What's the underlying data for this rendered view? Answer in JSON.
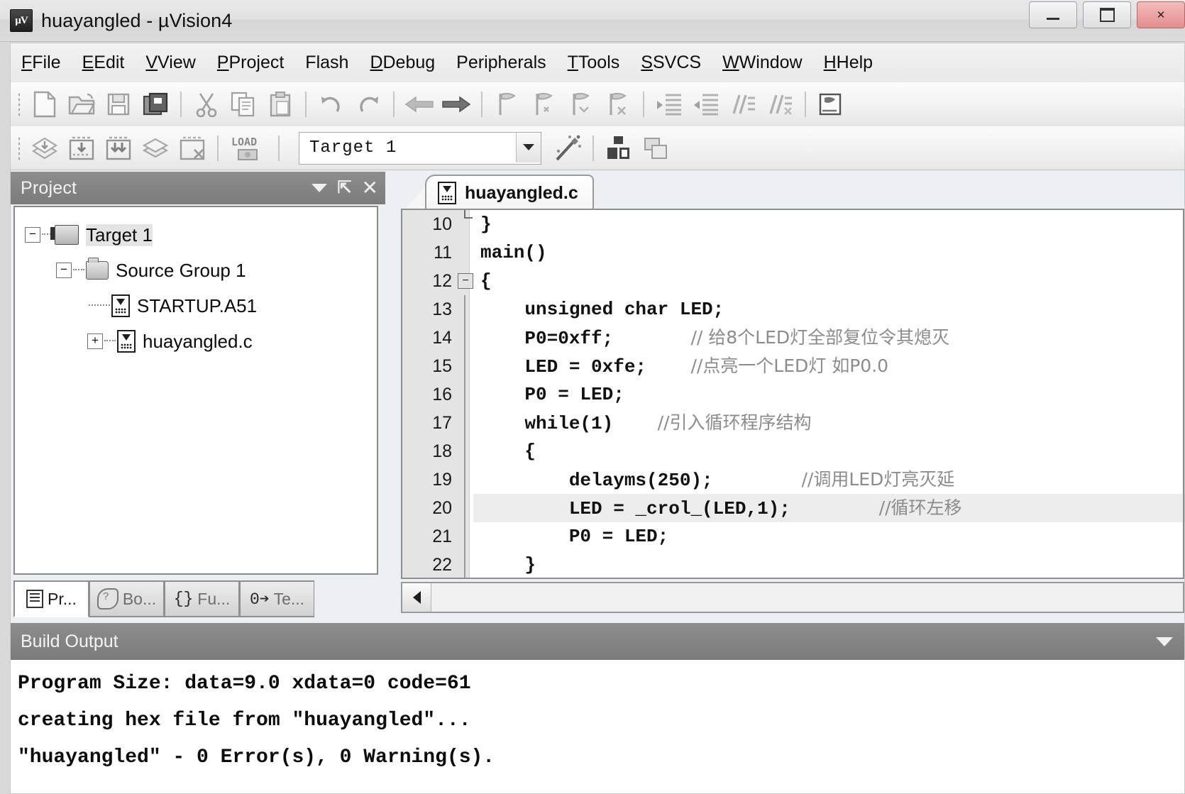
{
  "window": {
    "title": "huayangled  - µVision4",
    "app_icon": "uvision-icon",
    "buttons": {
      "minimize": "minimize-button",
      "maximize": "maximize-button",
      "close": "close-button"
    }
  },
  "menubar": {
    "items": [
      {
        "label": "File",
        "mnemonic": "F"
      },
      {
        "label": "Edit",
        "mnemonic": "E"
      },
      {
        "label": "View",
        "mnemonic": "V"
      },
      {
        "label": "Project",
        "mnemonic": "P"
      },
      {
        "label": "Flash",
        "mnemonic": "a"
      },
      {
        "label": "Debug",
        "mnemonic": "D"
      },
      {
        "label": "Peripherals",
        "mnemonic": "r"
      },
      {
        "label": "Tools",
        "mnemonic": "T"
      },
      {
        "label": "SVCS",
        "mnemonic": "S"
      },
      {
        "label": "Window",
        "mnemonic": "W"
      },
      {
        "label": "Help",
        "mnemonic": "H"
      }
    ]
  },
  "toolbar_file": {
    "buttons": [
      {
        "name": "new-file-icon",
        "glyph": "⬜"
      },
      {
        "name": "open-file-icon",
        "glyph": "📂"
      },
      {
        "name": "save-icon",
        "glyph": "💾"
      },
      {
        "name": "save-all-icon",
        "glyph": "📚"
      },
      {
        "name": "cut-icon",
        "glyph": "✂"
      },
      {
        "name": "copy-icon",
        "glyph": "⧉"
      },
      {
        "name": "paste-icon",
        "glyph": "📋"
      },
      {
        "name": "undo-icon",
        "glyph": "↶"
      },
      {
        "name": "redo-icon",
        "glyph": "↷"
      },
      {
        "name": "navigate-back-icon",
        "glyph": "⇐"
      },
      {
        "name": "navigate-forward-icon",
        "glyph": "⇒"
      },
      {
        "name": "bookmark-toggle-icon",
        "glyph": "⚑"
      },
      {
        "name": "bookmark-prev-icon",
        "glyph": "⚑"
      },
      {
        "name": "bookmark-next-icon",
        "glyph": "⚑"
      },
      {
        "name": "bookmark-clear-icon",
        "glyph": "⚑"
      },
      {
        "name": "indent-icon",
        "glyph": "≡"
      },
      {
        "name": "outdent-icon",
        "glyph": "≡"
      },
      {
        "name": "comment-icon",
        "glyph": "//"
      },
      {
        "name": "uncomment-icon",
        "glyph": "//"
      },
      {
        "name": "bookmark-window-icon",
        "glyph": "⎙"
      }
    ]
  },
  "toolbar_build": {
    "buttons": [
      {
        "name": "translate-icon",
        "glyph": "◧"
      },
      {
        "name": "build-target-icon",
        "glyph": "⬇"
      },
      {
        "name": "rebuild-all-icon",
        "glyph": "⬇"
      },
      {
        "name": "batch-build-icon",
        "glyph": "◩"
      },
      {
        "name": "stop-build-icon",
        "glyph": "✗"
      },
      {
        "name": "download-icon",
        "glyph": "LOAD"
      },
      {
        "name": "options-for-target-icon",
        "glyph": "✨"
      },
      {
        "name": "manage-components-icon",
        "glyph": "▣"
      },
      {
        "name": "multi-project-icon",
        "glyph": "❐"
      }
    ],
    "load_label": "LOAD",
    "target_select": {
      "value": "Target 1",
      "name": "target-select"
    }
  },
  "project_panel": {
    "title": "Project",
    "tree": [
      {
        "label": "Target 1",
        "level": 0,
        "icon": "target-icon",
        "expander": "−",
        "selected": true
      },
      {
        "label": "Source Group 1",
        "level": 1,
        "icon": "folder-icon",
        "expander": "−",
        "selected": false
      },
      {
        "label": "STARTUP.A51",
        "level": 2,
        "icon": "file-icon",
        "expander": "",
        "selected": false
      },
      {
        "label": "huayangled.c",
        "level": 2,
        "icon": "file-icon",
        "expander": "+",
        "selected": false
      }
    ],
    "tabs": [
      {
        "label": "Pr...",
        "icon": "project-icon",
        "active": true
      },
      {
        "label": "Bo...",
        "icon": "books-icon",
        "active": false
      },
      {
        "label": "Fu...",
        "icon": "functions-icon",
        "prefix": "{}",
        "active": false
      },
      {
        "label": "Te...",
        "icon": "templates-icon",
        "prefix": "0➔",
        "active": false
      }
    ]
  },
  "editor": {
    "tab": {
      "label": "huayangled.c",
      "icon": "c-file-icon"
    },
    "lines": [
      {
        "num": "10",
        "fold": "end",
        "text": "}",
        "comment": "",
        "highlight": false
      },
      {
        "num": "11",
        "fold": "none",
        "text": "main()",
        "comment": "",
        "highlight": false
      },
      {
        "num": "12",
        "fold": "box",
        "text": "{",
        "comment": "",
        "highlight": false
      },
      {
        "num": "13",
        "fold": "bar",
        "text": "    unsigned char LED;",
        "comment": "",
        "highlight": false
      },
      {
        "num": "14",
        "fold": "bar",
        "text": "    P0=0xff;       ",
        "comment": "// 给8个LED灯全部复位令其熄灭",
        "highlight": false
      },
      {
        "num": "15",
        "fold": "bar",
        "text": "    LED = 0xfe;    ",
        "comment": "//点亮一个LED灯 如P0.0",
        "highlight": false
      },
      {
        "num": "16",
        "fold": "bar",
        "text": "    P0 = LED;",
        "comment": "",
        "highlight": false
      },
      {
        "num": "17",
        "fold": "bar",
        "text": "    while(1)    ",
        "comment": "//引入循环程序结构",
        "highlight": false
      },
      {
        "num": "18",
        "fold": "bar",
        "text": "    {",
        "comment": "",
        "highlight": false
      },
      {
        "num": "19",
        "fold": "bar",
        "text": "        delayms(250);        ",
        "comment": "//调用LED灯亮灭延",
        "highlight": false
      },
      {
        "num": "20",
        "fold": "bar",
        "text": "        LED = _crol_(LED,1);        ",
        "comment": "//循环左移",
        "highlight": true
      },
      {
        "num": "21",
        "fold": "bar",
        "text": "        P0 = LED;",
        "comment": "",
        "highlight": false
      },
      {
        "num": "22",
        "fold": "bar",
        "text": "    }",
        "comment": "",
        "highlight": false
      }
    ],
    "hscroll_left": "scroll-left-arrow"
  },
  "build_output": {
    "title": "Build Output",
    "lines": [
      "Program Size: data=9.0 xdata=0 code=61",
      "creating hex file from \"huayangled\"...",
      "\"huayangled\" - 0 Error(s), 0 Warning(s)."
    ]
  },
  "colors": {
    "panel_header": "#7b7b7b",
    "gutter": "#e4e4e4",
    "highlight_line": "#ededed",
    "comment": "#8c8c8c"
  }
}
